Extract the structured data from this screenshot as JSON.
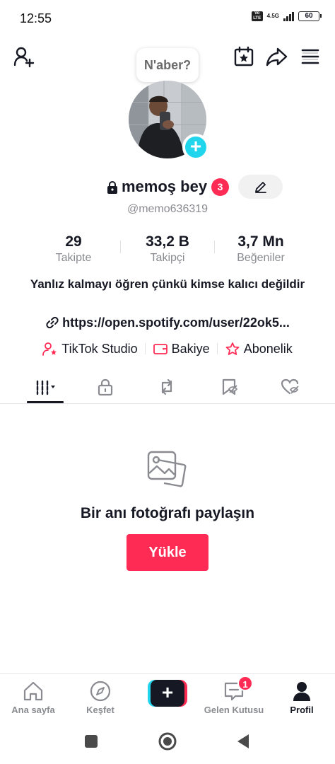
{
  "status_bar": {
    "time": "12:55",
    "volte": "Vo LTE",
    "network": "4.5G",
    "battery": "60"
  },
  "header": {
    "bubble_text": "N'aber?"
  },
  "profile": {
    "username": "memoş bey",
    "notification_count": "3",
    "handle": "@memo636319",
    "stats": [
      {
        "value": "29",
        "label": "Takipte"
      },
      {
        "value": "33,2 B",
        "label": "Takipçi"
      },
      {
        "value": "3,7 Mn",
        "label": "Beğeniler"
      }
    ],
    "bio": "Yanlız kalmayı öğren çünkü kimse kalıcı değildir",
    "link": "https://open.spotify.com/user/22ok5...",
    "quick_links": {
      "studio": "TikTok Studio",
      "balance": "Bakiye",
      "subscription": "Abonelik"
    }
  },
  "empty_state": {
    "title": "Bir anı fotoğrafı paylaşın",
    "button": "Yükle"
  },
  "bottom_nav": {
    "home": "Ana sayfa",
    "discover": "Keşfet",
    "create": "+",
    "inbox": "Gelen Kutusu",
    "inbox_badge": "1",
    "profile": "Profil"
  },
  "colors": {
    "accent": "#fe2c55",
    "cyan": "#20d5ec",
    "text": "#161823",
    "muted": "#8a8b91"
  }
}
